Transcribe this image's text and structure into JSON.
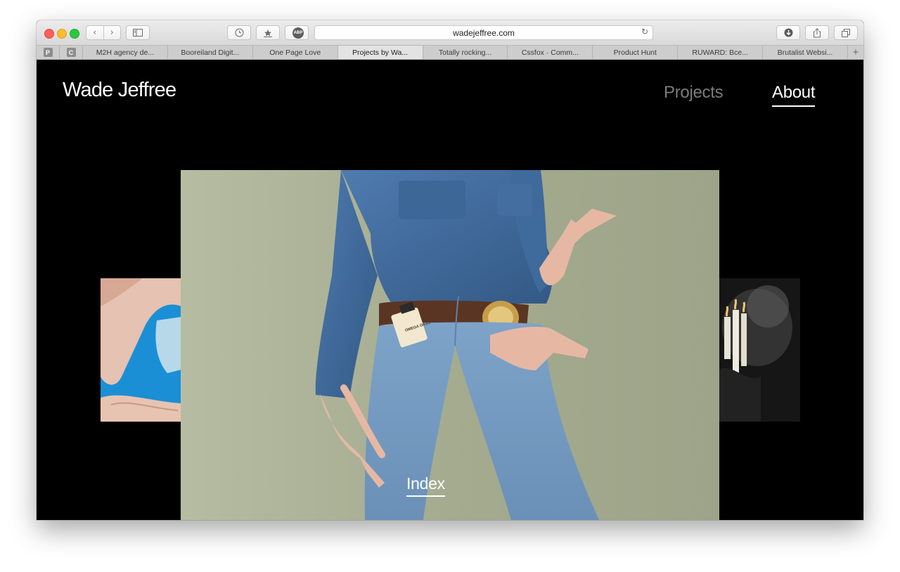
{
  "browser": {
    "url": "wadejeffree.com",
    "abp_label": "ABP",
    "pinned_tabs": [
      {
        "letter": "P"
      },
      {
        "letter": "C"
      }
    ],
    "tabs": [
      {
        "label": "M2H agency de...",
        "active": false
      },
      {
        "label": "Booreiland Digit...",
        "active": false
      },
      {
        "label": "One Page Love",
        "active": false
      },
      {
        "label": "Projects by Wa...",
        "active": true
      },
      {
        "label": "Totally rocking...",
        "active": false
      },
      {
        "label": "Cssfox · Comm...",
        "active": false
      },
      {
        "label": "Product Hunt",
        "active": false
      },
      {
        "label": "RUWARD: Всe...",
        "active": false
      },
      {
        "label": "Brutalist Websi...",
        "active": false
      }
    ],
    "new_tab_symbol": "+",
    "toolbar_icons": [
      "back-icon",
      "forward-icon",
      "sidebar-icon",
      "history-icon",
      "top-sites-icon",
      "adblock-icon",
      "reload-icon",
      "download-icon",
      "share-icon",
      "tabs-overview-icon"
    ]
  },
  "site": {
    "logo": "Wade Jeffree",
    "nav": {
      "projects": "Projects",
      "about": "About"
    },
    "index_link": "Index",
    "label_on_bottle": "OMEGA\nGRAS"
  },
  "colors": {
    "background": "#000000",
    "nav_active": "#ffffff",
    "nav_inactive": "#7c7c7c",
    "photo_backdrop": "#a7ad90",
    "left_thumb_blue": "#1b8fd5"
  }
}
